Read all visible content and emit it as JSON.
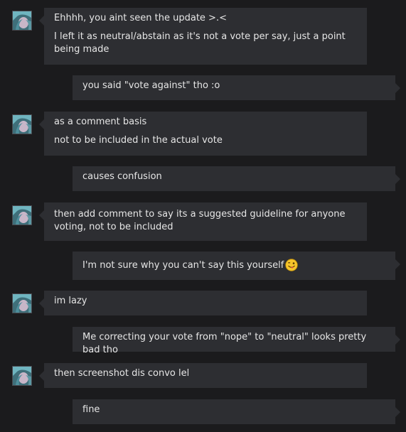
{
  "messages": [
    {
      "from": "them",
      "lines": [
        "Ehhhh, you aint seen the update >.<",
        "I left it as neutral/abstain as it's not a vote per say, just a point being made"
      ]
    },
    {
      "from": "me",
      "lines": [
        "you said \"vote against\" tho :o"
      ]
    },
    {
      "from": "them",
      "lines": [
        "as a comment basis",
        "not to be included in the actual vote"
      ]
    },
    {
      "from": "me",
      "lines": [
        "causes confusion"
      ]
    },
    {
      "from": "them",
      "lines": [
        "then add comment to say its a suggested guideline for anyone voting, not to be included"
      ]
    },
    {
      "from": "me",
      "lines": [
        "I'm not sure why you can't say this yourself"
      ],
      "emoji": "tongue-wink-emoji"
    },
    {
      "from": "them",
      "lines": [
        "im lazy"
      ]
    },
    {
      "from": "me",
      "lines": [
        "Me correcting your vote from \"nope\" to \"neutral\" looks pretty bad tho"
      ]
    },
    {
      "from": "them",
      "lines": [
        "then screenshot dis convo lel"
      ]
    },
    {
      "from": "me",
      "lines": [
        "fine"
      ]
    }
  ],
  "colors": {
    "background": "#1b1b1d",
    "bubble": "#2d2e32",
    "text": "#e6e6e6"
  }
}
